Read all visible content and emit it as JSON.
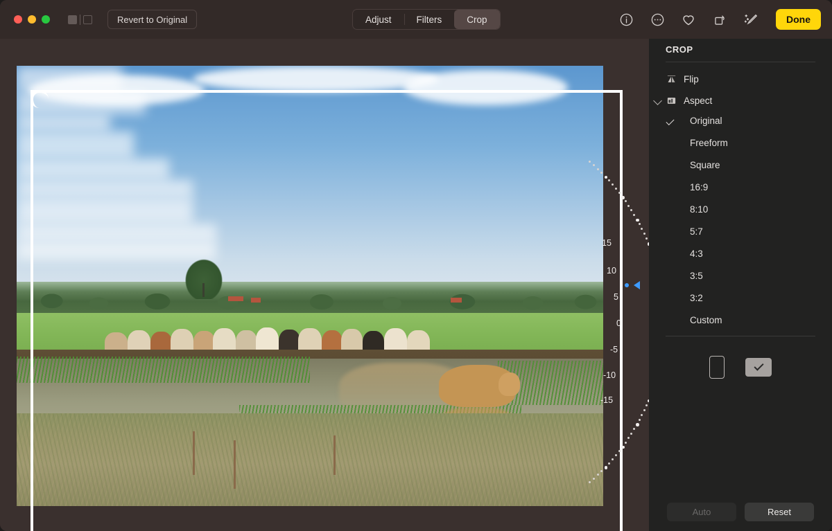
{
  "window": {
    "traffic_lights": [
      "close",
      "minimize",
      "zoom"
    ],
    "view_toggle_icon": "split-view-icon",
    "revert_label": "Revert to Original"
  },
  "toolbar": {
    "tabs": [
      {
        "label": "Adjust",
        "active": false
      },
      {
        "label": "Filters",
        "active": false
      },
      {
        "label": "Crop",
        "active": true
      }
    ],
    "icons": [
      {
        "name": "info-icon",
        "glyph": "i"
      },
      {
        "name": "more-options-icon",
        "glyph": "..."
      },
      {
        "name": "favorite-heart-icon",
        "glyph": "heart"
      },
      {
        "name": "rotate-icon",
        "glyph": "rotate"
      },
      {
        "name": "magic-wand-icon",
        "glyph": "wand"
      }
    ],
    "done_label": "Done",
    "done_color": "#ffd60a"
  },
  "sidebar": {
    "title": "CROP",
    "flip": {
      "label": "Flip",
      "icon": "flip-icon"
    },
    "aspect": {
      "label": "Aspect",
      "icon": "aspect-icon",
      "expanded": true
    },
    "aspect_options": [
      {
        "label": "Original",
        "selected": true
      },
      {
        "label": "Freeform",
        "selected": false
      },
      {
        "label": "Square",
        "selected": false
      },
      {
        "label": "16:9",
        "selected": false
      },
      {
        "label": "8:10",
        "selected": false
      },
      {
        "label": "5:7",
        "selected": false
      },
      {
        "label": "4:3",
        "selected": false
      },
      {
        "label": "3:5",
        "selected": false
      },
      {
        "label": "3:2",
        "selected": false
      },
      {
        "label": "Custom",
        "selected": false
      }
    ],
    "orientation": {
      "portrait": {
        "name": "portrait-orientation-button",
        "selected": false
      },
      "landscape": {
        "name": "landscape-orientation-button",
        "selected": true
      }
    },
    "footer": {
      "auto_label": "Auto",
      "auto_enabled": false,
      "reset_label": "Reset",
      "reset_enabled": true
    }
  },
  "rotation_dial": {
    "value": 0,
    "unit": "degrees",
    "indicator_color": "#3e9bff",
    "labels": [
      "15",
      "10",
      "5",
      "0",
      "-5",
      "-10",
      "-15"
    ]
  },
  "photo": {
    "subject": "herd of cows beside a pond in a green pasture",
    "crop_frame_visible": true
  }
}
